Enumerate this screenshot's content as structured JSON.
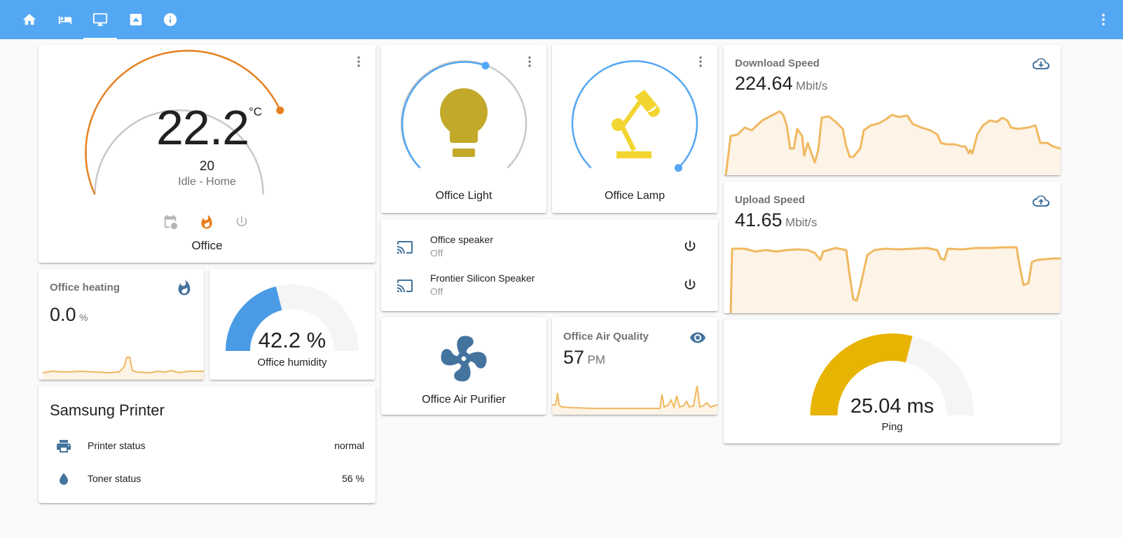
{
  "nav": {
    "tabs": [
      {
        "name": "home-icon"
      },
      {
        "name": "bed-icon"
      },
      {
        "name": "monitor-icon"
      },
      {
        "name": "image-icon"
      },
      {
        "name": "info-icon"
      }
    ],
    "active_tab": 2,
    "menu_icon": "dots-vertical-icon"
  },
  "thermostat": {
    "temperature": "22.2",
    "unit": "°C",
    "target": "20",
    "status": "Idle - Home",
    "name": "Office",
    "heat_color": "#e6801e"
  },
  "light": {
    "name": "Office Light",
    "icon_color": "#c3a92a"
  },
  "lamp": {
    "name": "Office Lamp",
    "icon_color": "#f2d531"
  },
  "speakers": [
    {
      "name": "Office speaker",
      "state": "Off"
    },
    {
      "name": "Frontier Silicon Speaker",
      "state": "Off"
    }
  ],
  "download": {
    "title": "Download Speed",
    "value": "224.64",
    "unit": "Mbit/s"
  },
  "upload": {
    "title": "Upload Speed",
    "value": "41.65",
    "unit": "Mbit/s"
  },
  "heating": {
    "title": "Office heating",
    "value": "0.0",
    "unit": "%"
  },
  "humidity": {
    "value": "42.2 %",
    "label": "Office humidity",
    "fraction": 0.422,
    "color": "#4a9be6"
  },
  "purifier": {
    "name": "Office Air Purifier"
  },
  "air_quality": {
    "title": "Office Air Quality",
    "value": "57",
    "unit": "PM"
  },
  "ping": {
    "value": "25.04 ms",
    "label": "Ping",
    "fraction": 0.58,
    "color": "#e8b404"
  },
  "printer": {
    "title": "Samsung Printer",
    "rows": [
      {
        "label": "Printer status",
        "value": "normal"
      },
      {
        "label": "Toner status",
        "value": "56 %"
      }
    ]
  },
  "colors": {
    "accent": "#54a7f3",
    "sparkline": "#f0b860",
    "sparkline_fill": "#fdf3e6",
    "icon": "#44739e"
  }
}
